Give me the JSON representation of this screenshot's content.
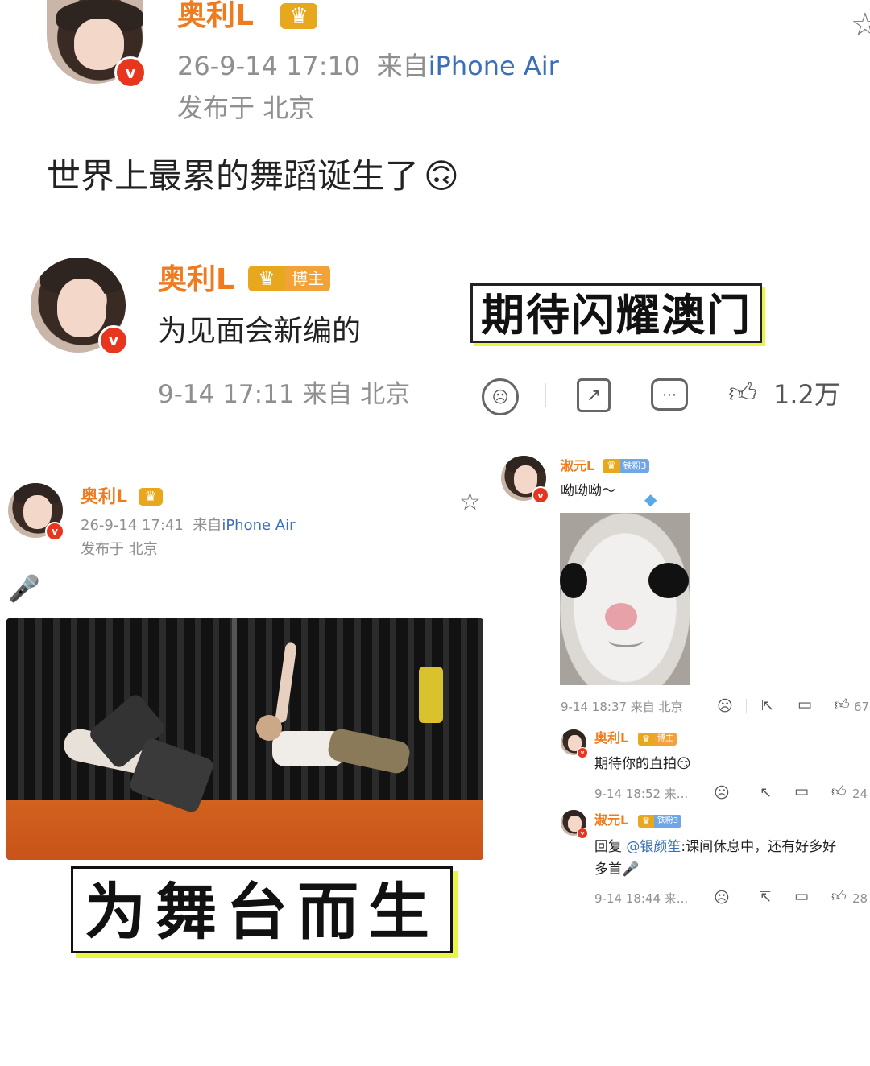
{
  "post1": {
    "author": "奥利L",
    "timestamp": "26-9-14 17:10",
    "source_prefix": "来自",
    "source_device": "iPhone Air",
    "location": "发布于 北京",
    "text": "世界上最累的舞蹈诞生了",
    "emoji": "🙃"
  },
  "reply1": {
    "author": "奥利L",
    "badge": "博主",
    "text": "为见面会新编的",
    "sticker": "期待闪耀澳门",
    "meta": "9-14 17:11 来自 北京",
    "like_count": "1.2万"
  },
  "post2": {
    "author": "奥利L",
    "timestamp": "26-9-14 17:41",
    "source_prefix": "来自",
    "source_device": "iPhone Air",
    "location": "发布于 北京",
    "emoji": "🎤",
    "caption": "为舞台而生"
  },
  "comment1": {
    "author": "淑元L",
    "badge": "铁粉3",
    "text": "呦呦呦～",
    "meta": "9-14 18:37 来自 北京",
    "like_count": "67"
  },
  "comment2": {
    "author": "奥利L",
    "badge": "博主",
    "text": "期待你的直拍",
    "emoji": "😏",
    "meta": "9-14 18:52 来...",
    "like_count": "24"
  },
  "comment3": {
    "author": "淑元L",
    "badge": "铁粉3",
    "reply_prefix": "回复",
    "mention": "@银颜笙",
    "text": ":课间休息中，还有好多好",
    "text2": "多首",
    "emoji": "🎤",
    "meta": "9-14 18:44 来...",
    "like_count": "28"
  },
  "icons": [
    "crown-icon",
    "star-icon",
    "dislike-icon",
    "share-icon",
    "comment-icon",
    "like-icon"
  ],
  "colors": {
    "name_orange": "#f07b1e",
    "verified_red": "#e8351d",
    "link_blue": "#3b6fb6",
    "sticker_yellow": "#e9f542"
  }
}
